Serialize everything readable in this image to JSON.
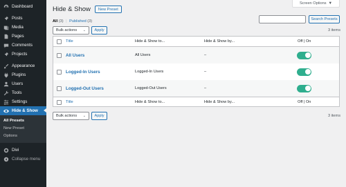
{
  "sidebar": {
    "items": [
      {
        "label": "Dashboard",
        "icon": "dashboard-icon"
      },
      {
        "label": "Posts",
        "icon": "pin-icon"
      },
      {
        "label": "Media",
        "icon": "media-icon"
      },
      {
        "label": "Pages",
        "icon": "pages-icon"
      },
      {
        "label": "Comments",
        "icon": "comments-icon"
      },
      {
        "label": "Projects",
        "icon": "pin-icon"
      },
      {
        "label": "Appearance",
        "icon": "brush-icon"
      },
      {
        "label": "Plugins",
        "icon": "plugin-icon"
      },
      {
        "label": "Users",
        "icon": "user-icon"
      },
      {
        "label": "Tools",
        "icon": "wrench-icon"
      },
      {
        "label": "Settings",
        "icon": "settings-icon"
      },
      {
        "label": "Hide & Show",
        "icon": "eye-icon"
      }
    ],
    "submenu": [
      "All Presets",
      "New Preset",
      "Options"
    ],
    "bottom": [
      {
        "label": "Divi",
        "icon": "divi-icon"
      },
      {
        "label": "Collapse menu",
        "icon": "collapse-icon"
      }
    ]
  },
  "header": {
    "screen_options": "Screen Options",
    "title": "Hide & Show",
    "new_preset": "New Preset"
  },
  "views": {
    "all_label": "All",
    "all_count": "(3)",
    "separator": "|",
    "published_label": "Published",
    "published_count": "(3)"
  },
  "search": {
    "value": "",
    "button": "Search Presets"
  },
  "bulk": {
    "label": "Bulk actions",
    "apply": "Apply",
    "count": "3 items"
  },
  "table": {
    "columns": [
      "Title",
      "Hide & Show to...",
      "Hide & Show by...",
      "Off | On"
    ],
    "rows": [
      {
        "title": "All Users",
        "hide_show_to": "All Users",
        "hide_show_by": "–",
        "enabled": true
      },
      {
        "title": "Logged-In Users",
        "hide_show_to": "Logged-In Users",
        "hide_show_by": "–",
        "enabled": true
      },
      {
        "title": "Logged-Out Users",
        "hide_show_to": "Logged-Out Users",
        "hide_show_by": "–",
        "enabled": true
      }
    ]
  },
  "colors": {
    "accent": "#2271b1",
    "sidebar": "#1d2327",
    "toggle_on": "#2fae8e"
  }
}
